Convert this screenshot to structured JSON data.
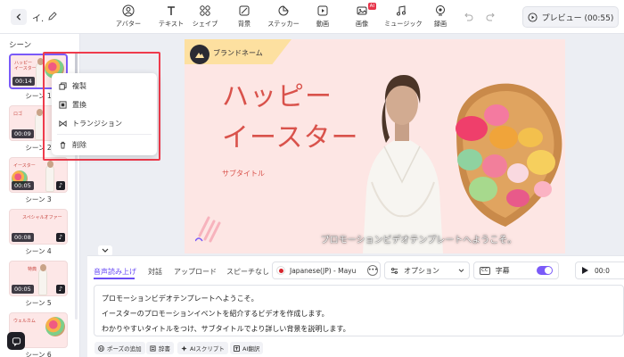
{
  "header": {
    "project_title": "イ.",
    "tools": [
      {
        "label": "アバター",
        "icon": "avatar-icon"
      },
      {
        "label": "テキスト",
        "icon": "text-icon"
      },
      {
        "label": "シェイプ",
        "icon": "shape-icon"
      },
      {
        "label": "背景",
        "icon": "background-icon"
      },
      {
        "label": "ステッカー",
        "icon": "sticker-icon"
      },
      {
        "label": "動画",
        "icon": "video-icon"
      },
      {
        "label": "画像",
        "icon": "image-icon",
        "badge": "AI"
      },
      {
        "label": "ミュージック",
        "icon": "music-icon"
      },
      {
        "label": "録画",
        "icon": "record-icon"
      }
    ],
    "preview_label": "プレビュー (00:55)"
  },
  "sidebar": {
    "title": "シーン",
    "scenes": [
      {
        "label": "シーン 1",
        "duration": "00:14",
        "thumb_title": "ハッピー\nイースター",
        "active": true
      },
      {
        "label": "シーン 2",
        "duration": "00:09",
        "thumb_title": "ロゴ"
      },
      {
        "label": "シーン 3",
        "duration": "00:05",
        "thumb_title": "イースター"
      },
      {
        "label": "シーン 4",
        "duration": "00:08",
        "thumb_title": "スペシャルオファー"
      },
      {
        "label": "シーン 5",
        "duration": "00:05",
        "thumb_title": "特典"
      },
      {
        "label": "シーン 6",
        "duration": "",
        "thumb_title": "ウェルカム"
      }
    ]
  },
  "context_menu": {
    "items": [
      {
        "label": "複製",
        "icon": "duplicate-icon"
      },
      {
        "label": "置換",
        "icon": "replace-icon"
      },
      {
        "label": "トランジション",
        "icon": "transition-icon"
      },
      {
        "label": "削除",
        "icon": "trash-icon"
      }
    ]
  },
  "canvas": {
    "brand_name": "ブランドネーム",
    "title_line1": "ハッピー",
    "title_line2": "イースター",
    "subtitle": "サブタイトル",
    "caption": "プロモーションビデオテンプレートへようこそ。"
  },
  "script_panel": {
    "tabs": [
      "音声読み上げ",
      "対話",
      "アップロード",
      "スピーチなし"
    ],
    "active_tab": "音声読み上げ",
    "voice": "Japanese(JP) - Mayu",
    "option_label": "オプション",
    "caption_label": "字幕",
    "caption_enabled": true,
    "play_time": "00:0",
    "lines": [
      "プロモーションビデオテンプレートへようこそ。",
      "イースターのプロモーションイベントを紹介するビデオを作成します。",
      "わかりやすいタイトルをつけ、サブタイトルでより詳しい背景を説明します。"
    ],
    "chips": [
      {
        "label": "ポーズの追加",
        "icon": "pause-icon"
      },
      {
        "label": "辞書",
        "icon": "dictionary-icon"
      },
      {
        "label": "AIスクリプト",
        "icon": "ai-script-icon"
      },
      {
        "label": "AI翻訳",
        "icon": "ai-translate-icon"
      }
    ]
  },
  "colors": {
    "accent": "#6a4cf5",
    "highlight": "#ef3b4c",
    "title_red": "#d9524b",
    "canvas_bg": "#fde6e4"
  }
}
